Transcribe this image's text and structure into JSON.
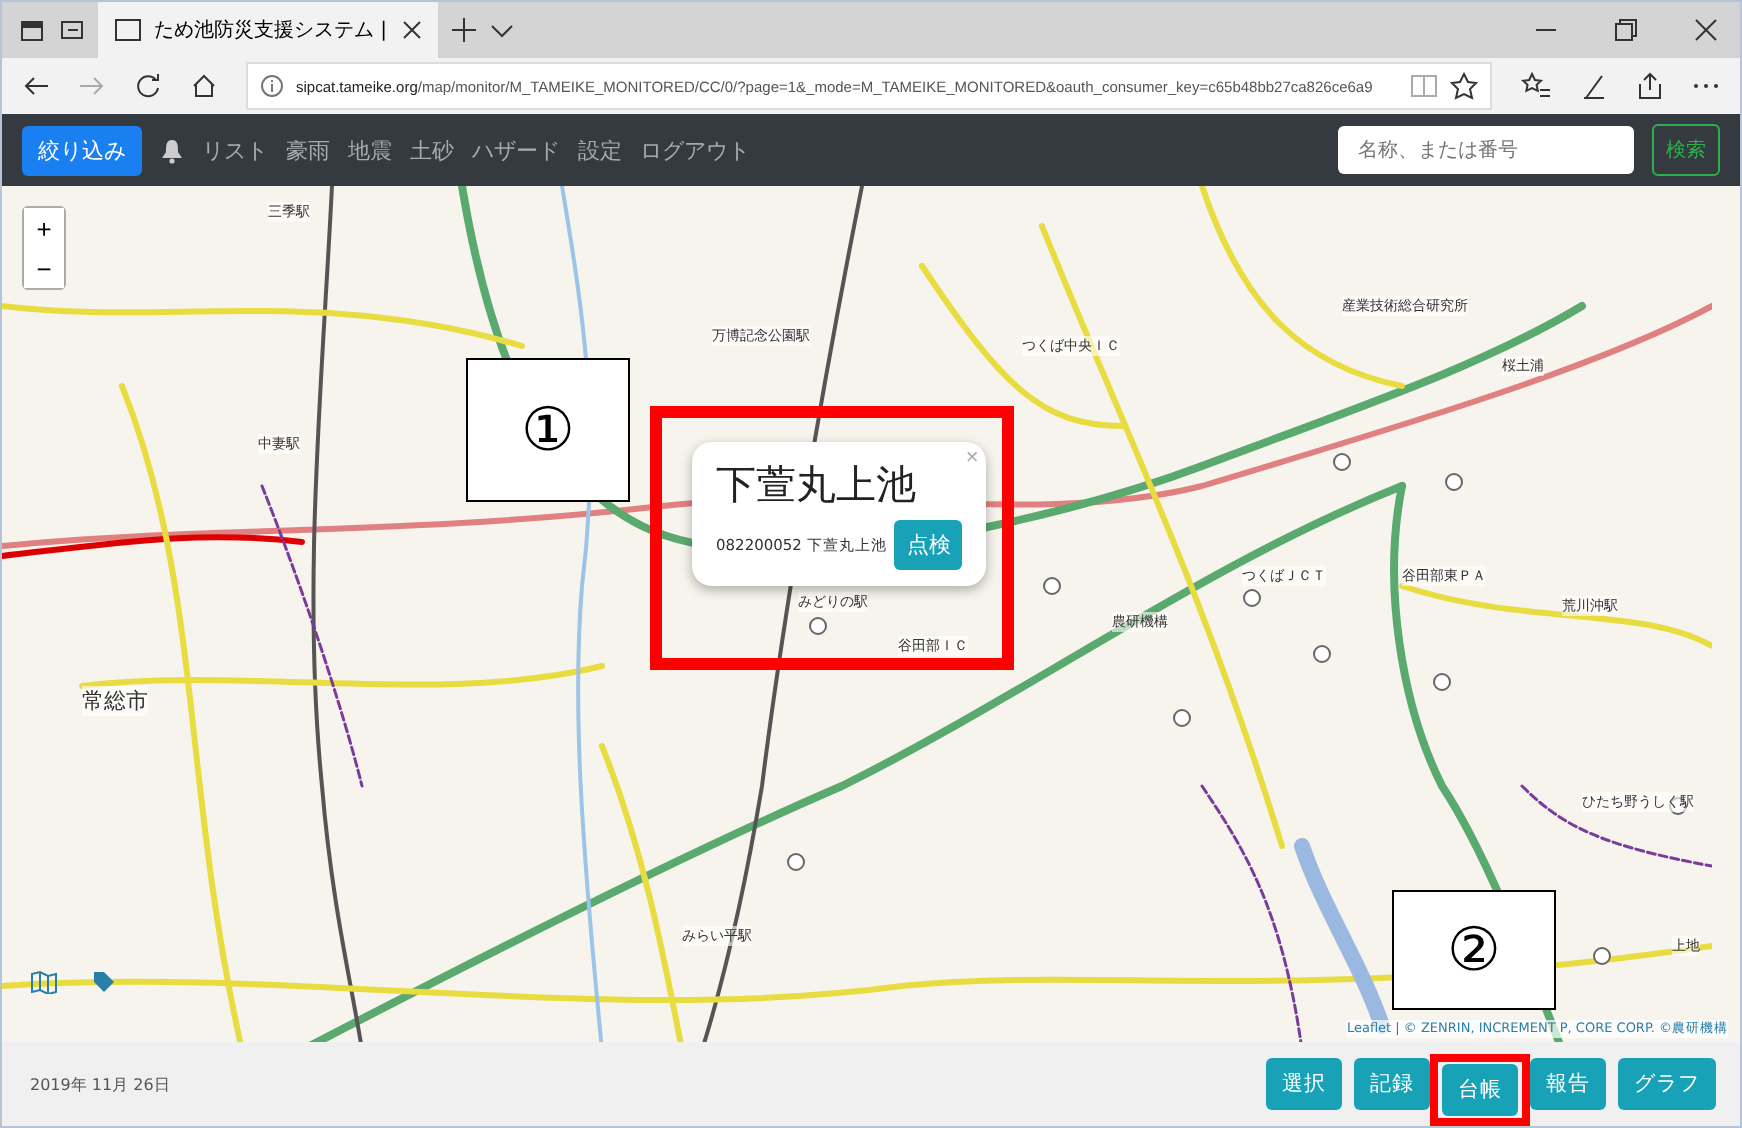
{
  "browser": {
    "tab_title": "ため池防災支援システム |",
    "url_host": "sipcat.tameike.org",
    "url_path": "/map/monitor/M_TAMEIKE_MONITORED/CC/0/?page=1&_mode=M_TAMEIKE_MONITORED&oauth_consumer_key=c65b48bb27ca826ce6a9"
  },
  "navbar": {
    "filter_button": "絞り込み",
    "links": [
      "リスト",
      "豪雨",
      "地震",
      "土砂",
      "ハザード",
      "設定",
      "ログアウト"
    ],
    "search": {
      "placeholder": "名称、または番号"
    },
    "search_button": "検索"
  },
  "map": {
    "zoom_in": "+",
    "zoom_out": "−",
    "labels": [
      "三季駅",
      "中妻駅",
      "常総市",
      "万博記念公園駅",
      "つくば中央ＩＣ",
      "産業技術総合研究所",
      "桜土浦",
      "谷田部東ＰＡ",
      "つくばＪＣＴ",
      "農研機構",
      "荒川沖駅",
      "ひたち野うしく駅",
      "みらい平駅",
      "みどりの駅",
      "谷田部ＩＣ",
      "上地"
    ],
    "popup": {
      "title": "下萱丸上池",
      "code": "082200052 下萱丸上池",
      "button": "点検",
      "close": "×"
    },
    "attribution": "Leaflet | © ZENRIN, INCREMENT P, CORE CORP. ©農研機構"
  },
  "annotations": [
    {
      "number": "①"
    },
    {
      "number": "②"
    }
  ],
  "footer": {
    "date": "2019年 11月 26日",
    "buttons": [
      "選択",
      "記録",
      "台帳",
      "報告",
      "グラフ"
    ]
  }
}
